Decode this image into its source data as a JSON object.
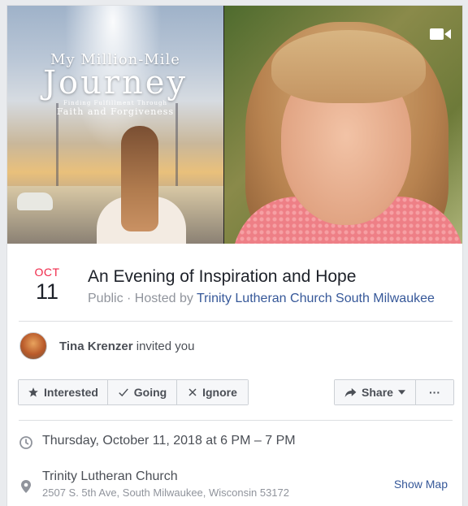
{
  "cover": {
    "book_title_line1": "My Million-Mile",
    "book_title_line2": "Journey",
    "book_subtitle_line1": "Finding Fulfillment Through",
    "book_subtitle_line2": "Faith and Forgiveness",
    "video_icon": "video-camera-icon"
  },
  "event": {
    "month": "OCT",
    "day": "11",
    "title": "An Evening of Inspiration and Hope",
    "privacy": "Public",
    "separator": " · ",
    "hosted_by_label": "Hosted by ",
    "host": "Trinity Lutheran Church South Milwaukee"
  },
  "invite": {
    "name": "Tina Krenzer",
    "text": " invited you"
  },
  "actions": {
    "interested": "Interested",
    "going": "Going",
    "ignore": "Ignore",
    "share": "Share",
    "more": "···"
  },
  "details": {
    "time": "Thursday, October 11, 2018 at 6 PM – 7 PM",
    "location_name": "Trinity Lutheran Church",
    "location_address": "2507 S. 5th Ave, South Milwaukee, Wisconsin 53172",
    "show_map": "Show Map"
  },
  "colors": {
    "accent_red": "#f02849",
    "link_blue": "#365899",
    "muted_text": "#90949c"
  }
}
